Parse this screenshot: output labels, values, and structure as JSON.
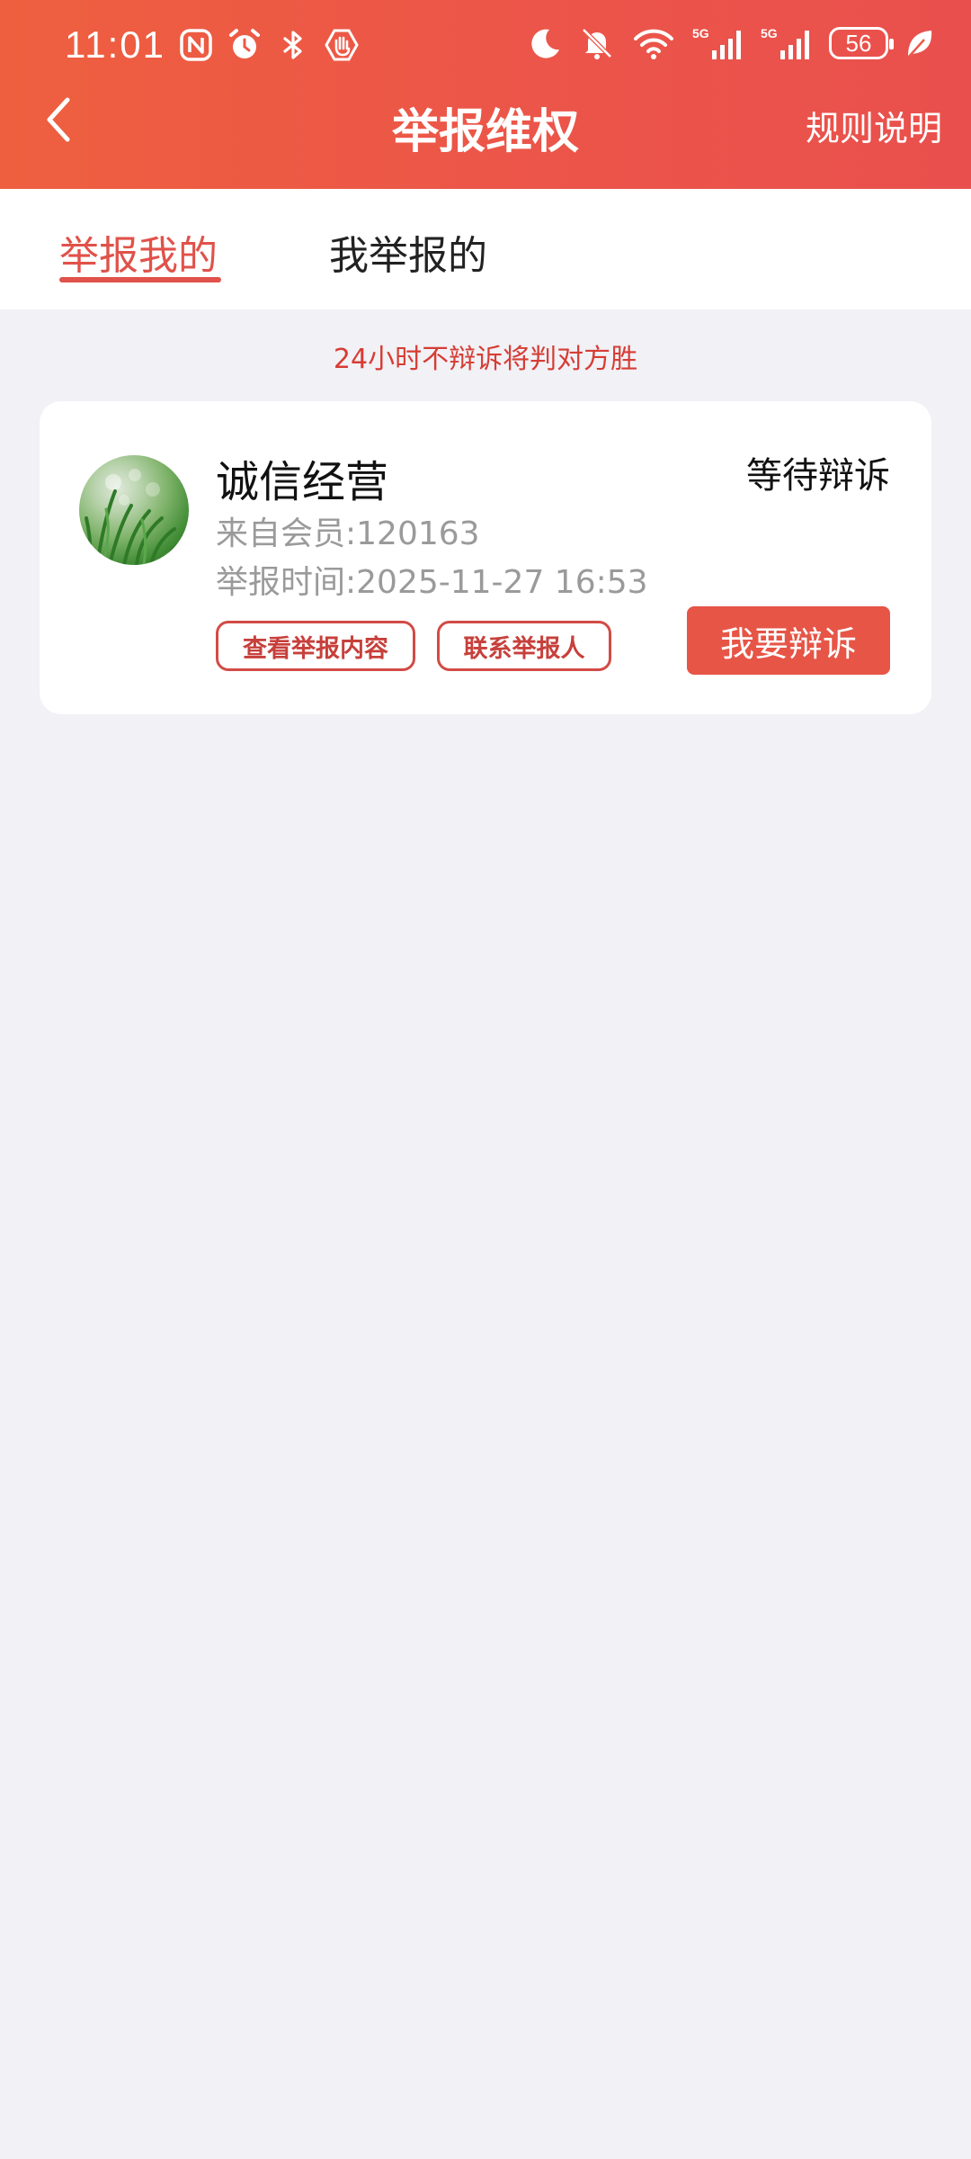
{
  "status_bar": {
    "time": "11:01",
    "battery": "56"
  },
  "nav": {
    "title": "举报维权",
    "rules_link": "规则说明"
  },
  "tabs": [
    {
      "label": "举报我的",
      "active": true
    },
    {
      "label": "我举报的",
      "active": false
    }
  ],
  "notice": "24小时不辩诉将判对方胜",
  "report": {
    "name": "诚信经营",
    "status": "等待辩诉",
    "from_member": "来自会员:120163",
    "report_time": "举报时间:2025-11-27 16:53",
    "view_button": "查看举报内容",
    "contact_button": "联系举报人",
    "appeal_button": "我要辩诉"
  },
  "colors": {
    "header_start": "#ee5f3f",
    "header_end": "#e9504d",
    "accent_red": "#e0524a",
    "appeal_button": "#e65546",
    "page_background": "#f1f1f6"
  },
  "icons": {
    "status_left": [
      "nfc-icon",
      "alarm-icon",
      "bluetooth-icon",
      "hand-shield-icon"
    ],
    "status_right": [
      "moon-icon",
      "bell-muted-icon",
      "wifi-icon",
      "signal-5g-icon",
      "signal-5g-icon",
      "battery-icon",
      "leaf-icon"
    ],
    "nav_back": "chevron-left-icon"
  }
}
